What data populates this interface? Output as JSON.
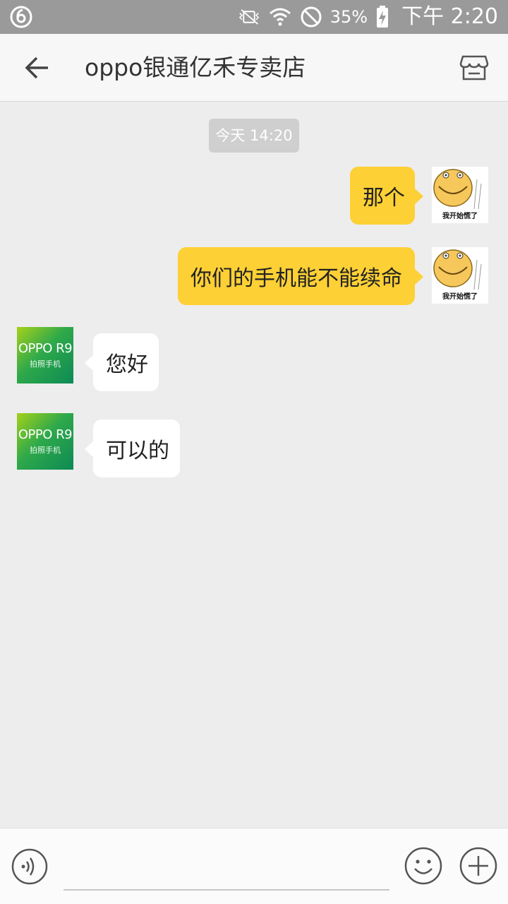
{
  "status_bar": {
    "battery_percent": "35%",
    "time": "下午 2:20",
    "icons": [
      "netease-music-icon",
      "vibrate-mute-icon",
      "wifi-icon",
      "do-not-disturb-icon",
      "battery-charging-icon"
    ]
  },
  "header": {
    "title": "oppo银通亿禾专卖店",
    "back_icon": "arrow-left-icon",
    "shop_icon": "store-icon"
  },
  "chat": {
    "timestamp": "今天 14:20",
    "user_avatar_caption": "我开始慌了",
    "shop_avatar": {
      "brand": "OPPO R9",
      "subtitle": "拍照手机"
    },
    "messages": [
      {
        "from": "me",
        "text": "那个"
      },
      {
        "from": "me",
        "text": "你们的手机能不能续命"
      },
      {
        "from": "shop",
        "text": "您好"
      },
      {
        "from": "shop",
        "text": "可以的"
      }
    ]
  },
  "input_bar": {
    "value": "",
    "placeholder": "",
    "icons": [
      "voice-icon",
      "emoji-icon",
      "plus-icon"
    ]
  },
  "colors": {
    "status_bar_bg": "#9a9a9a",
    "header_bg": "#f7f7f7",
    "chat_bg": "#ededed",
    "outgoing_bubble": "#fdd035",
    "incoming_bubble": "#ffffff",
    "timestamp_bg": "#cfcfcf"
  }
}
